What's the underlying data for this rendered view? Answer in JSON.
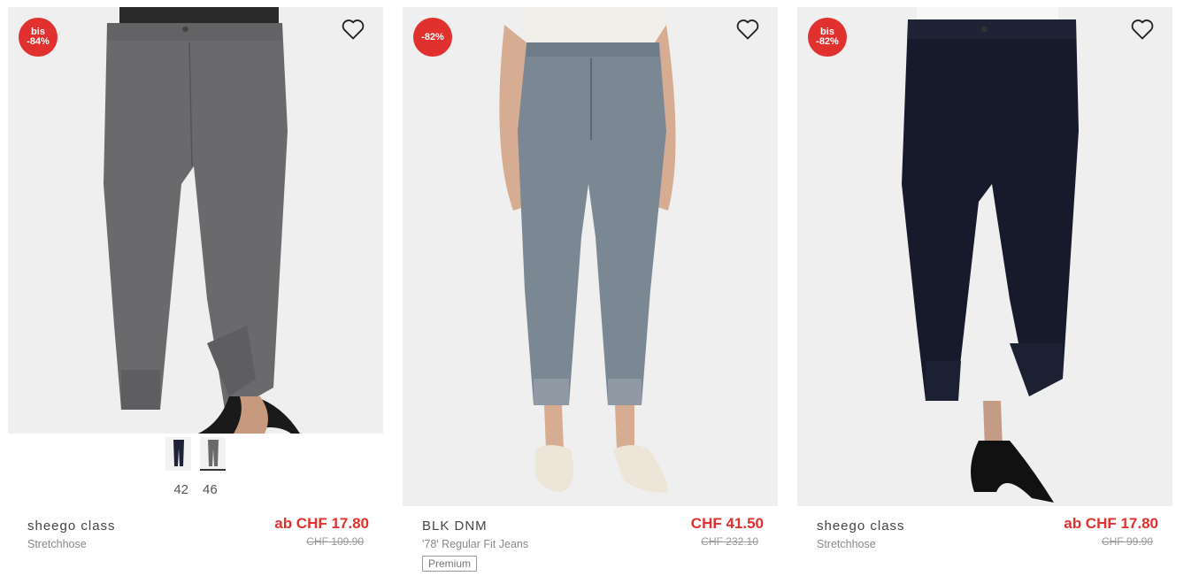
{
  "products": [
    {
      "badge_line1": "bis",
      "badge_line2": "-84%",
      "brand": "sheego class",
      "name": "Stretchhose",
      "price": "ab CHF 17.80",
      "old_price": "CHF 109.90",
      "sizes": [
        "42",
        "46"
      ],
      "color_variants": [
        "navy",
        "grey"
      ],
      "garment_color": "#6a6a6c"
    },
    {
      "badge_line1": "",
      "badge_line2": "-82%",
      "brand": "BLK DNM",
      "name": "'78' Regular Fit Jeans",
      "price": "CHF 41.50",
      "old_price": "CHF 232.10",
      "tag": "Premium",
      "garment_color": "#7b8792"
    },
    {
      "badge_line1": "bis",
      "badge_line2": "-82%",
      "brand": "sheego class",
      "name": "Stretchhose",
      "price": "ab CHF 17.80",
      "old_price": "CHF 99.90",
      "garment_color": "#161a2b"
    }
  ],
  "icons": {
    "wishlist": "heart-outline-icon"
  },
  "colors": {
    "sale": "#e0312f",
    "navy": "#1d2237",
    "grey": "#6a6a6c"
  }
}
